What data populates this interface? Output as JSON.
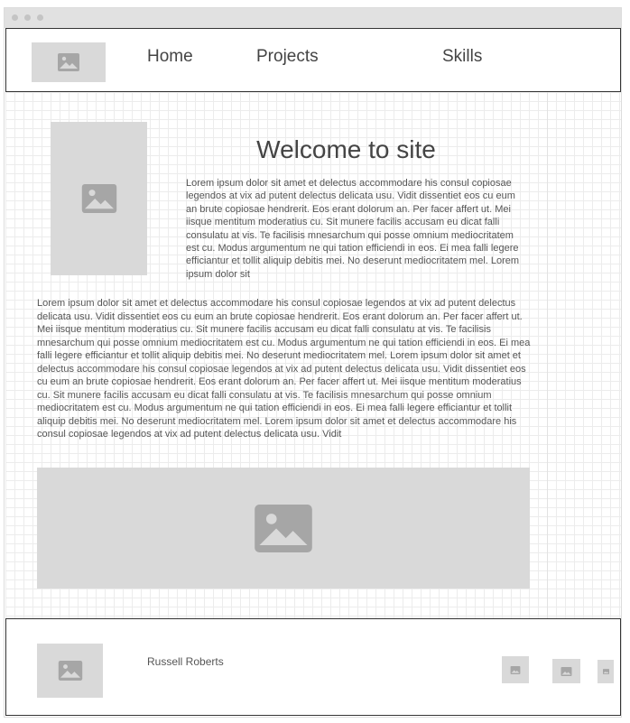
{
  "nav": {
    "items": [
      {
        "label": "Home"
      },
      {
        "label": "Projects"
      },
      {
        "label": "Skills"
      }
    ]
  },
  "main": {
    "title": "Welcome to site",
    "intro_text": "Lorem ipsum dolor sit amet et delectus accommodare his consul copiosae legendos at vix ad putent delectus delicata usu. Vidit dissentiet eos cu eum an brute copiosae hendrerit. Eos erant dolorum an. Per facer affert ut. Mei iisque mentitum moderatius cu. Sit munere facilis accusam eu dicat falli consulatu at vis. Te facilisis mnesarchum qui posse omnium mediocritatem est cu. Modus argumentum ne qui tation efficiendi in eos. Ei mea falli legere efficiantur et tollit aliquip debitis mei. No deserunt mediocritatem mel. Lorem ipsum dolor sit",
    "body_text": "Lorem ipsum dolor sit amet et delectus accommodare his consul copiosae legendos at vix ad putent delectus delicata usu. Vidit dissentiet eos cu eum an brute copiosae hendrerit. Eos erant dolorum an. Per facer affert ut. Mei iisque mentitum moderatius cu. Sit munere facilis accusam eu dicat falli consulatu at vis. Te facilisis mnesarchum qui posse omnium mediocritatem est cu. Modus argumentum ne qui tation efficiendi in eos. Ei mea falli legere efficiantur et tollit aliquip debitis mei. No deserunt mediocritatem mel. Lorem ipsum dolor sit amet et delectus accommodare his consul copiosae legendos at vix ad putent delectus delicata usu. Vidit dissentiet eos cu eum an brute copiosae hendrerit. Eos erant dolorum an. Per facer affert ut. Mei iisque mentitum moderatius cu. Sit munere facilis accusam eu dicat falli consulatu at vis. Te facilisis mnesarchum qui posse omnium mediocritatem est cu. Modus argumentum ne qui tation efficiendi in eos. Ei mea falli legere efficiantur et tollit aliquip debitis mei. No deserunt mediocritatem mel. Lorem ipsum dolor sit amet et delectus accommodare his consul copiosae legendos at vix ad putent delectus delicata usu. Vidit"
  },
  "footer": {
    "author": "Russell Roberts"
  },
  "colors": {
    "placeholder": "#d9d9d9",
    "placeholder_icon": "#a6a6a6",
    "border": "#333333",
    "text": "#444444"
  },
  "icons": {
    "placeholder": "image-icon"
  }
}
